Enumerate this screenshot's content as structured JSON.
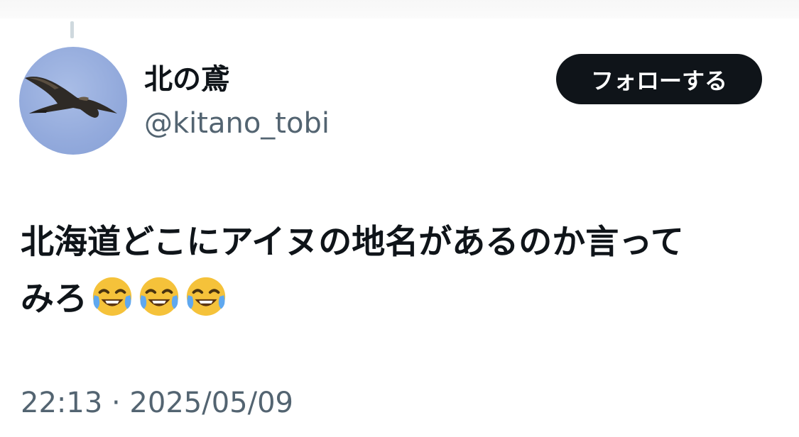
{
  "thread": {
    "connector": "reply-thread-line"
  },
  "author": {
    "display_name": "北の鳶",
    "handle": "@kitano_tobi",
    "avatar_icon": "kite-bird-avatar"
  },
  "follow_button": {
    "label": "フォローする"
  },
  "tweet": {
    "text_line_1": "北海道どこにアイヌの地名があるのか言って",
    "text_line_2": "みろ",
    "emojis": [
      "face-with-tears-of-joy",
      "face-with-tears-of-joy",
      "face-with-tears-of-joy"
    ]
  },
  "timestamp": "22:13 · 2025/05/09",
  "colors": {
    "text_primary": "#0f1419",
    "text_secondary": "#536471",
    "follow_bg": "#0f1419",
    "follow_fg": "#ffffff",
    "avatar_sky": "#93aadc"
  }
}
